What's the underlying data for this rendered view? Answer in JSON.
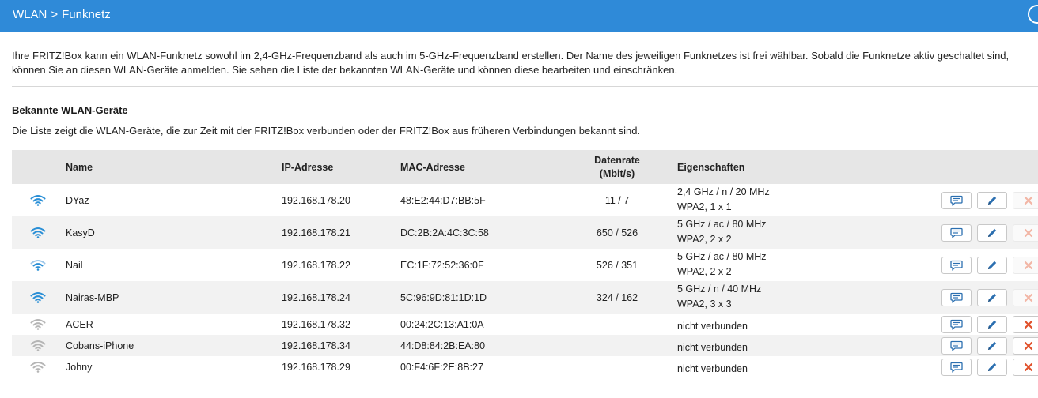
{
  "header": {
    "breadcrumb_parent": "WLAN",
    "breadcrumb_separator": ">",
    "breadcrumb_current": "Funknetz",
    "background_color": "#2f8ad8"
  },
  "intro": {
    "text": "Ihre FRITZ!Box kann ein WLAN-Funknetz sowohl im 2,4-GHz-Frequenzband als auch im 5-GHz-Frequenzband erstellen. Der Name des jeweiligen Funknetzes ist frei wählbar. Sobald die Funknetze aktiv geschaltet sind, können Sie an diesen WLAN-Geräte anmelden. Sie sehen die Liste der bekannten WLAN-Geräte und können diese bearbeiten und einschränken."
  },
  "section": {
    "title": "Bekannte WLAN-Geräte",
    "description": "Die Liste zeigt die WLAN-Geräte, die zur Zeit mit der FRITZ!Box verbunden oder der FRITZ!Box aus früheren Verbindungen bekannt sind."
  },
  "table": {
    "headers": {
      "name": "Name",
      "ip": "IP-Adresse",
      "mac": "MAC-Adresse",
      "rate_line1": "Datenrate",
      "rate_line2": "(Mbit/s)",
      "props": "Eigenschaften"
    },
    "rows": [
      {
        "name": "DYaz",
        "ip": "192.168.178.20",
        "mac": "48:E2:44:D7:BB:5F",
        "rate": "11 / 7",
        "props1": "2,4 GHz / n / 20 MHz",
        "props2": "WPA2, 1 x 1",
        "signal_icon": "wifi-signal-strong-icon",
        "connected": true
      },
      {
        "name": "KasyD",
        "ip": "192.168.178.21",
        "mac": "DC:2B:2A:4C:3C:58",
        "rate": "650 / 526",
        "props1": "5 GHz / ac / 80 MHz",
        "props2": "WPA2, 2 x 2",
        "signal_icon": "wifi-signal-strong-icon",
        "connected": true
      },
      {
        "name": "Nail",
        "ip": "192.168.178.22",
        "mac": "EC:1F:72:52:36:0F",
        "rate": "526 / 351",
        "props1": "5 GHz / ac / 80 MHz",
        "props2": "WPA2, 2 x 2",
        "signal_icon": "wifi-signal-medium-icon",
        "connected": true
      },
      {
        "name": "Nairas-MBP",
        "ip": "192.168.178.24",
        "mac": "5C:96:9D:81:1D:1D",
        "rate": "324 / 162",
        "props1": "5 GHz / n / 40 MHz",
        "props2": "WPA2, 3 x 3",
        "signal_icon": "wifi-signal-strong-icon",
        "connected": true
      },
      {
        "name": "ACER",
        "ip": "192.168.178.32",
        "mac": "00:24:2C:13:A1:0A",
        "rate": "",
        "props1": "nicht verbunden",
        "props2": "",
        "signal_icon": "wifi-disconnected-icon",
        "connected": false
      },
      {
        "name": "Cobans-iPhone",
        "ip": "192.168.178.34",
        "mac": "44:D8:84:2B:EA:80",
        "rate": "",
        "props1": "nicht verbunden",
        "props2": "",
        "signal_icon": "wifi-disconnected-icon",
        "connected": false
      },
      {
        "name": "Johny",
        "ip": "192.168.178.29",
        "mac": "00:F4:6F:2E:8B:27",
        "rate": "",
        "props1": "nicht verbunden",
        "props2": "",
        "signal_icon": "wifi-disconnected-icon",
        "connected": false
      }
    ]
  },
  "colors": {
    "accent": "#2f8ad8",
    "wifi_active": "#2a8fd6",
    "wifi_weak": "#9ec7e9",
    "wifi_inactive": "#b5b5b5",
    "edit_icon": "#2b6fb0",
    "delete_active": "#e0502a",
    "delete_disabled": "#f2b6a6"
  }
}
